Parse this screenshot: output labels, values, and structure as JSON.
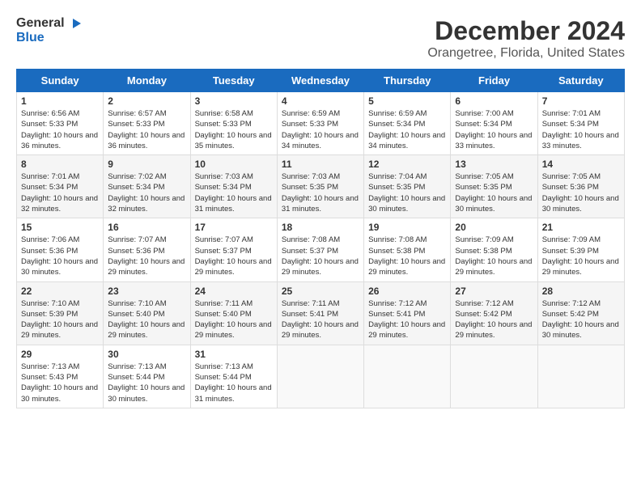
{
  "logo": {
    "general": "General",
    "blue": "Blue"
  },
  "title": "December 2024",
  "subtitle": "Orangetree, Florida, United States",
  "days_of_week": [
    "Sunday",
    "Monday",
    "Tuesday",
    "Wednesday",
    "Thursday",
    "Friday",
    "Saturday"
  ],
  "weeks": [
    [
      {
        "day": "1",
        "sunrise": "6:56 AM",
        "sunset": "5:33 PM",
        "daylight": "10 hours and 36 minutes."
      },
      {
        "day": "2",
        "sunrise": "6:57 AM",
        "sunset": "5:33 PM",
        "daylight": "10 hours and 36 minutes."
      },
      {
        "day": "3",
        "sunrise": "6:58 AM",
        "sunset": "5:33 PM",
        "daylight": "10 hours and 35 minutes."
      },
      {
        "day": "4",
        "sunrise": "6:59 AM",
        "sunset": "5:33 PM",
        "daylight": "10 hours and 34 minutes."
      },
      {
        "day": "5",
        "sunrise": "6:59 AM",
        "sunset": "5:34 PM",
        "daylight": "10 hours and 34 minutes."
      },
      {
        "day": "6",
        "sunrise": "7:00 AM",
        "sunset": "5:34 PM",
        "daylight": "10 hours and 33 minutes."
      },
      {
        "day": "7",
        "sunrise": "7:01 AM",
        "sunset": "5:34 PM",
        "daylight": "10 hours and 33 minutes."
      }
    ],
    [
      {
        "day": "8",
        "sunrise": "7:01 AM",
        "sunset": "5:34 PM",
        "daylight": "10 hours and 32 minutes."
      },
      {
        "day": "9",
        "sunrise": "7:02 AM",
        "sunset": "5:34 PM",
        "daylight": "10 hours and 32 minutes."
      },
      {
        "day": "10",
        "sunrise": "7:03 AM",
        "sunset": "5:34 PM",
        "daylight": "10 hours and 31 minutes."
      },
      {
        "day": "11",
        "sunrise": "7:03 AM",
        "sunset": "5:35 PM",
        "daylight": "10 hours and 31 minutes."
      },
      {
        "day": "12",
        "sunrise": "7:04 AM",
        "sunset": "5:35 PM",
        "daylight": "10 hours and 30 minutes."
      },
      {
        "day": "13",
        "sunrise": "7:05 AM",
        "sunset": "5:35 PM",
        "daylight": "10 hours and 30 minutes."
      },
      {
        "day": "14",
        "sunrise": "7:05 AM",
        "sunset": "5:36 PM",
        "daylight": "10 hours and 30 minutes."
      }
    ],
    [
      {
        "day": "15",
        "sunrise": "7:06 AM",
        "sunset": "5:36 PM",
        "daylight": "10 hours and 30 minutes."
      },
      {
        "day": "16",
        "sunrise": "7:07 AM",
        "sunset": "5:36 PM",
        "daylight": "10 hours and 29 minutes."
      },
      {
        "day": "17",
        "sunrise": "7:07 AM",
        "sunset": "5:37 PM",
        "daylight": "10 hours and 29 minutes."
      },
      {
        "day": "18",
        "sunrise": "7:08 AM",
        "sunset": "5:37 PM",
        "daylight": "10 hours and 29 minutes."
      },
      {
        "day": "19",
        "sunrise": "7:08 AM",
        "sunset": "5:38 PM",
        "daylight": "10 hours and 29 minutes."
      },
      {
        "day": "20",
        "sunrise": "7:09 AM",
        "sunset": "5:38 PM",
        "daylight": "10 hours and 29 minutes."
      },
      {
        "day": "21",
        "sunrise": "7:09 AM",
        "sunset": "5:39 PM",
        "daylight": "10 hours and 29 minutes."
      }
    ],
    [
      {
        "day": "22",
        "sunrise": "7:10 AM",
        "sunset": "5:39 PM",
        "daylight": "10 hours and 29 minutes."
      },
      {
        "day": "23",
        "sunrise": "7:10 AM",
        "sunset": "5:40 PM",
        "daylight": "10 hours and 29 minutes."
      },
      {
        "day": "24",
        "sunrise": "7:11 AM",
        "sunset": "5:40 PM",
        "daylight": "10 hours and 29 minutes."
      },
      {
        "day": "25",
        "sunrise": "7:11 AM",
        "sunset": "5:41 PM",
        "daylight": "10 hours and 29 minutes."
      },
      {
        "day": "26",
        "sunrise": "7:12 AM",
        "sunset": "5:41 PM",
        "daylight": "10 hours and 29 minutes."
      },
      {
        "day": "27",
        "sunrise": "7:12 AM",
        "sunset": "5:42 PM",
        "daylight": "10 hours and 29 minutes."
      },
      {
        "day": "28",
        "sunrise": "7:12 AM",
        "sunset": "5:42 PM",
        "daylight": "10 hours and 30 minutes."
      }
    ],
    [
      {
        "day": "29",
        "sunrise": "7:13 AM",
        "sunset": "5:43 PM",
        "daylight": "10 hours and 30 minutes."
      },
      {
        "day": "30",
        "sunrise": "7:13 AM",
        "sunset": "5:44 PM",
        "daylight": "10 hours and 30 minutes."
      },
      {
        "day": "31",
        "sunrise": "7:13 AM",
        "sunset": "5:44 PM",
        "daylight": "10 hours and 31 minutes."
      },
      null,
      null,
      null,
      null
    ]
  ],
  "labels": {
    "sunrise_prefix": "Sunrise: ",
    "sunset_prefix": "Sunset: ",
    "daylight_prefix": "Daylight: "
  }
}
